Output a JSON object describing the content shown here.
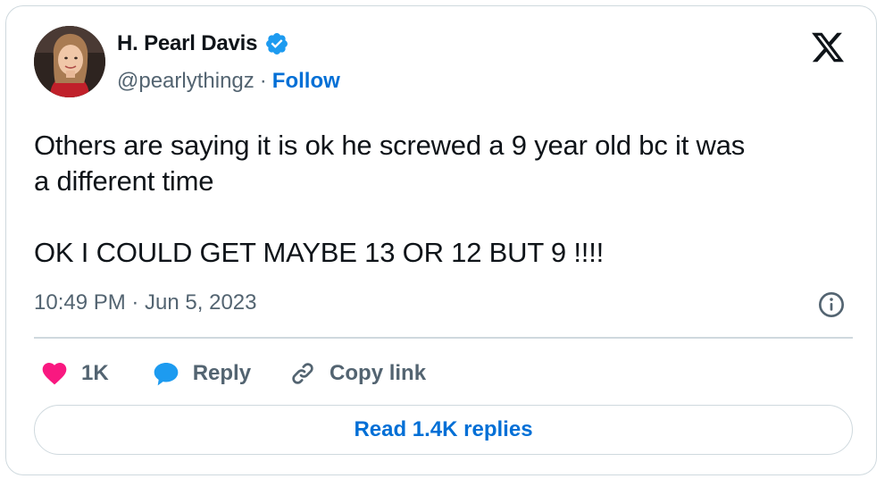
{
  "author": {
    "name": "H. Pearl Davis",
    "handle": "@pearlythingz",
    "separator": "·",
    "follow_label": "Follow",
    "verified": true
  },
  "tweet": {
    "text": "Others are saying it is ok he screwed a 9 year old bc it was\na different time\n\nOK I COULD GET MAYBE 13 OR 12 BUT 9 !!!!",
    "timestamp": "10:49 PM · Jun 5, 2023"
  },
  "actions": {
    "like_count": "1K",
    "reply_label": "Reply",
    "copy_link_label": "Copy link"
  },
  "read_replies_label": "Read 1.4K replies",
  "colors": {
    "text_primary": "#0f1419",
    "text_secondary": "#536471",
    "link_blue": "#006fd6",
    "verified_blue": "#1d9bf0",
    "like_red": "#f91880",
    "border": "#cfd9de"
  },
  "icons": {
    "platform_logo": "x-logo-icon",
    "verified_badge": "verified-badge-icon",
    "info": "info-icon",
    "like": "heart-icon",
    "reply": "reply-bubble-icon",
    "copy_link": "link-icon"
  }
}
